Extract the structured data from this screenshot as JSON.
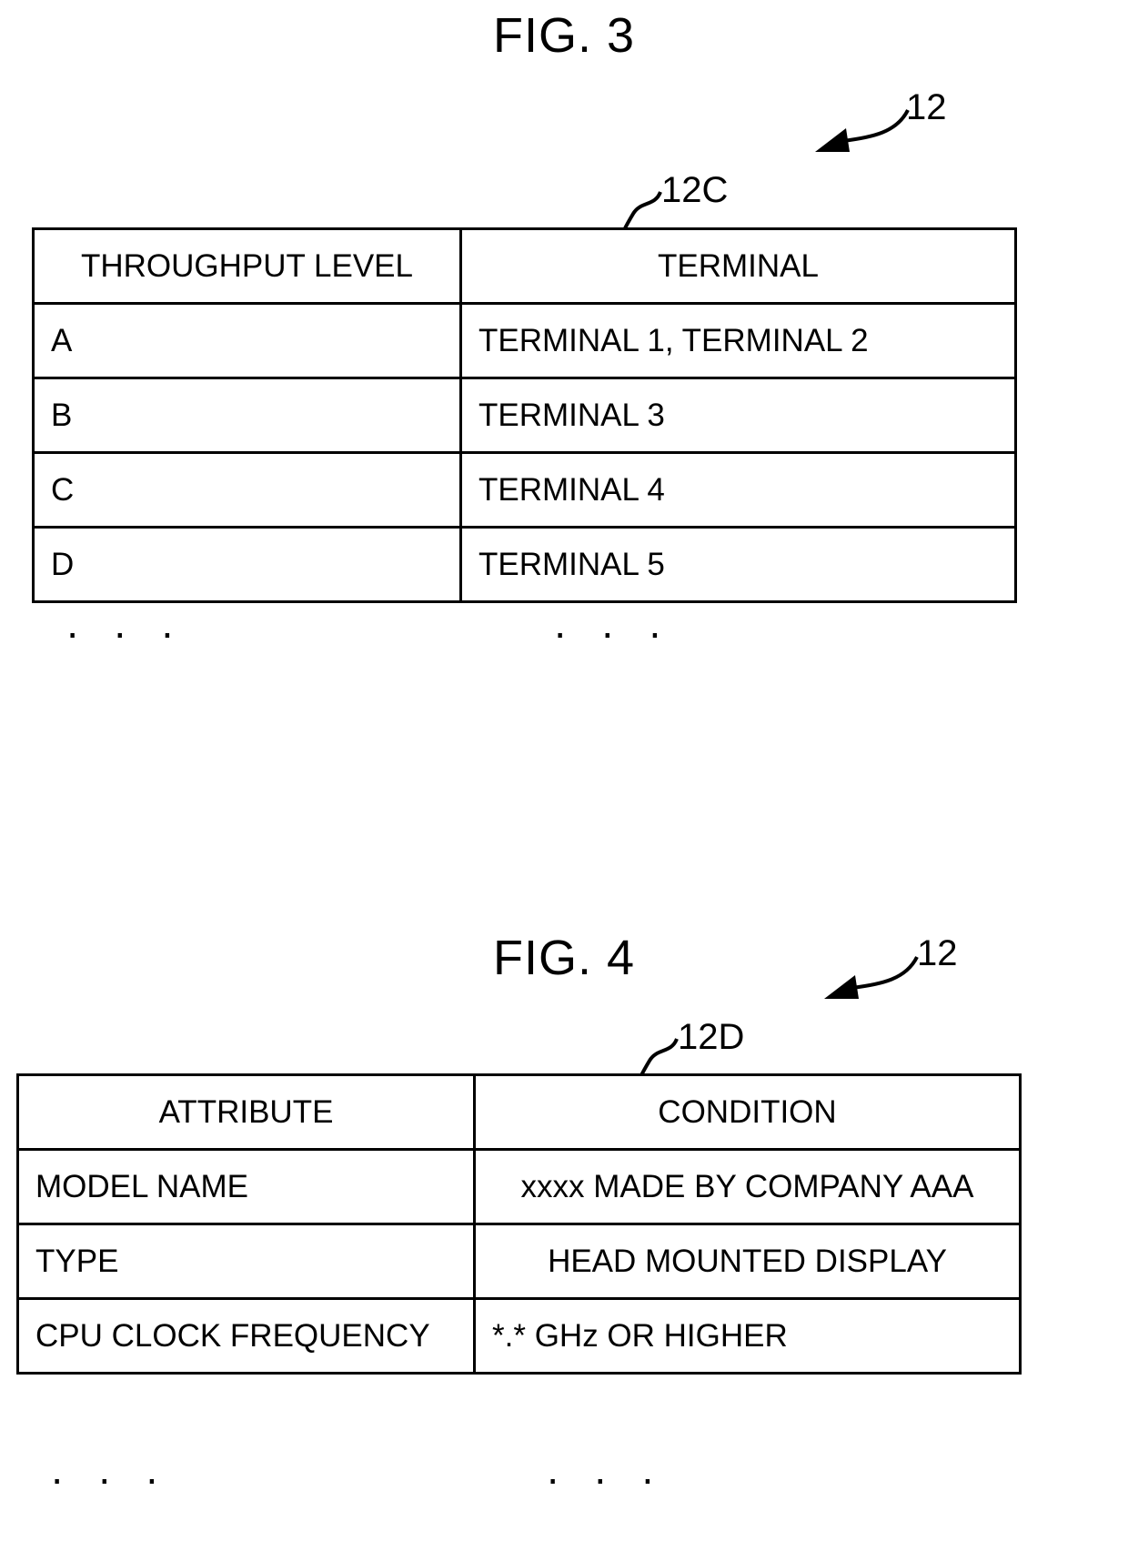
{
  "figures": [
    {
      "title": "FIG. 3",
      "table_ref": "12C",
      "system_ref": "12",
      "ellipsis": "· · ·",
      "table": {
        "headers": [
          "THROUGHPUT LEVEL",
          "TERMINAL"
        ],
        "rows": [
          [
            "A",
            "TERMINAL 1, TERMINAL 2"
          ],
          [
            "B",
            "TERMINAL 3"
          ],
          [
            "C",
            "TERMINAL 4"
          ],
          [
            "D",
            "TERMINAL 5"
          ]
        ]
      }
    },
    {
      "title": "FIG. 4",
      "table_ref": "12D",
      "system_ref": "12",
      "ellipsis": "· · ·",
      "table": {
        "headers": [
          "ATTRIBUTE",
          "CONDITION"
        ],
        "rows": [
          [
            "MODEL NAME",
            "xxxx MADE BY COMPANY AAA"
          ],
          [
            "TYPE",
            "HEAD MOUNTED DISPLAY"
          ],
          [
            "CPU CLOCK FREQUENCY",
            "*.* GHz OR HIGHER"
          ]
        ]
      }
    }
  ],
  "colors": {
    "ink": "#000000",
    "paper": "#ffffff"
  }
}
